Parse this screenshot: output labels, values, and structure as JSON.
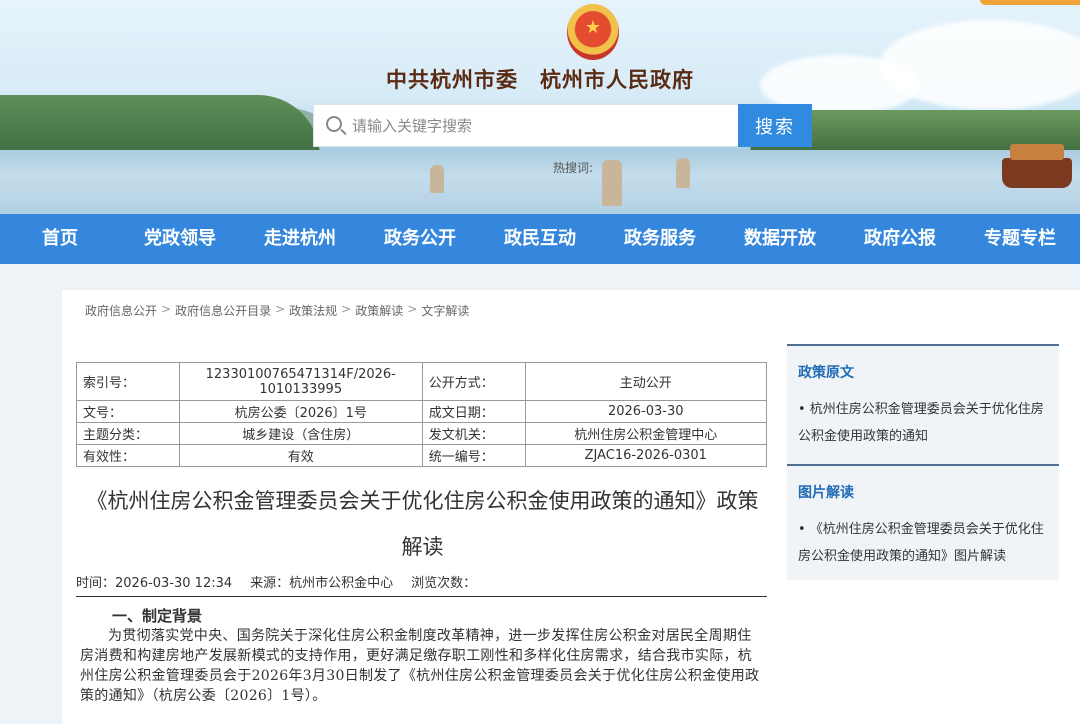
{
  "header": {
    "emblem_glyph": "★",
    "site_title": "中共杭州市委　杭州市人民政府",
    "search": {
      "placeholder": "请输入关键字搜索",
      "button_label": "搜索"
    },
    "hot_search_label": "热搜词:"
  },
  "nav": {
    "items": [
      "首页",
      "党政领导",
      "走进杭州",
      "政务公开",
      "政民互动",
      "政务服务",
      "数据开放",
      "政府公报",
      "专题专栏"
    ]
  },
  "breadcrumb": [
    "政府信息公开",
    "政府信息公开目录",
    "政策法规",
    "政策解读",
    "文字解读"
  ],
  "breadcrumb_separator": ">",
  "meta": {
    "rows": [
      {
        "k1": "索引号：",
        "v1": "12330100765471314F/2026-1010133995",
        "k2": "公开方式：",
        "v2": "主动公开"
      },
      {
        "k1": "文号：",
        "v1": "杭房公委〔2026〕1号",
        "k2": "成文日期：",
        "v2": "2026-03-30"
      },
      {
        "k1": "主题分类：",
        "v1": "城乡建设（含住房）",
        "k2": "发文机关：",
        "v2": "杭州住房公积金管理中心"
      },
      {
        "k1": "有效性：",
        "v1": "有效",
        "k2": "统一编号：",
        "v2": "ZJAC16-2026-0301"
      }
    ]
  },
  "article": {
    "title": "《杭州住房公积金管理委员会关于优化住房公积金使用政策的通知》政策解读",
    "time": "时间：2026-03-30 12:34",
    "source": "来源：杭州市公积金中心",
    "views": "浏览次数：",
    "section_heading": "一、制定背景",
    "paragraph": "为贯彻落实党中央、国务院关于深化住房公积金制度改革精神，进一步发挥住房公积金对居民全周期住房消费和构建房地产发展新模式的支持作用，更好满足缴存职工刚性和多样化住房需求，结合我市实际，杭州住房公积金管理委员会于2026年3月30日制发了《杭州住房公积金管理委员会关于优化住房公积金使用政策的通知》（杭房公委〔2026〕1号）。"
  },
  "sidebar": {
    "policy_original": {
      "heading": "政策原文",
      "link": "• 杭州住房公积金管理委员会关于优化住房公积金使用政策的通知"
    },
    "picture_reading": {
      "heading": "图片解读",
      "link": "• 《杭州住房公积金管理委员会关于优化住房公积金使用政策的通知》图片解读"
    }
  },
  "colors": {
    "nav_blue": "#3487dc",
    "search_button": "#2f8ae0",
    "side_heading": "#1f6cb5",
    "title_brown": "#5a2a12"
  }
}
